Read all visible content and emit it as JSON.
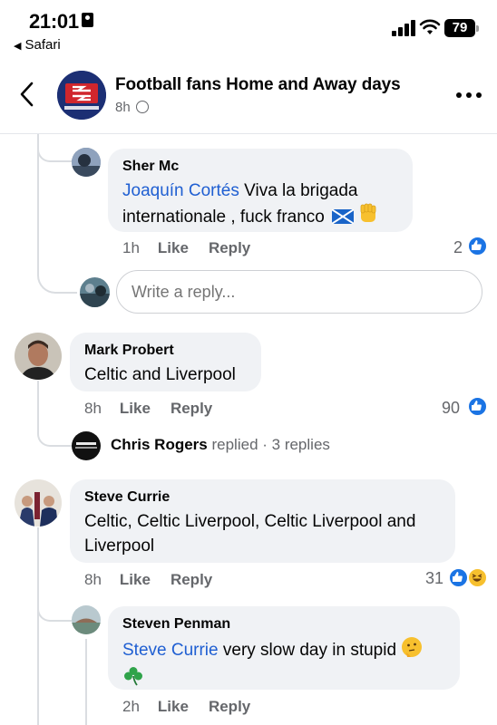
{
  "status_bar": {
    "time": "21:01",
    "back_app": "Safari",
    "battery": "79"
  },
  "header": {
    "group_name": "Football fans Home and Away days",
    "age": "8h"
  },
  "comments": [
    {
      "id": "sher",
      "author": "Sher Mc",
      "mention": "Joaquín Cortés",
      "text": " Viva  la brigada internationale , fuck franco",
      "time": "1h",
      "like": "Like",
      "reply": "Reply",
      "reaction_count": "2"
    },
    {
      "id": "mark",
      "author": "Mark Probert",
      "text": "Celtic and Liverpool",
      "time": "8h",
      "like": "Like",
      "reply": "Reply",
      "reaction_count": "90"
    },
    {
      "id": "steve",
      "author": "Steve Currie",
      "text": "Celtic, Celtic Liverpool, Celtic Liverpool and Liverpool",
      "time": "8h",
      "like": "Like",
      "reply": "Reply",
      "reaction_count": "31"
    },
    {
      "id": "steven",
      "author": "Steven Penman",
      "mention": "Steve Currie",
      "text": " very slow day in stupid",
      "time": "2h",
      "like": "Like",
      "reply": "Reply"
    }
  ],
  "reply_input": {
    "placeholder": "Write a reply..."
  },
  "replied_summary": {
    "name": "Chris Rogers",
    "verb": "replied",
    "count": " · 3 replies"
  },
  "colors": {
    "mention": "#1f5fd2",
    "bubble": "#f0f2f5",
    "like_blue": "#1b74e4",
    "logo_navy": "#1c2f74",
    "logo_red": "#d0262d"
  },
  "icons": [
    "back-chevron-icon",
    "globe-icon",
    "more-dots-icon",
    "like-reaction-icon",
    "haha-reaction-icon",
    "scotland-flag-emoji",
    "raised-fist-emoji",
    "thinking-face-emoji",
    "shamrock-emoji"
  ]
}
